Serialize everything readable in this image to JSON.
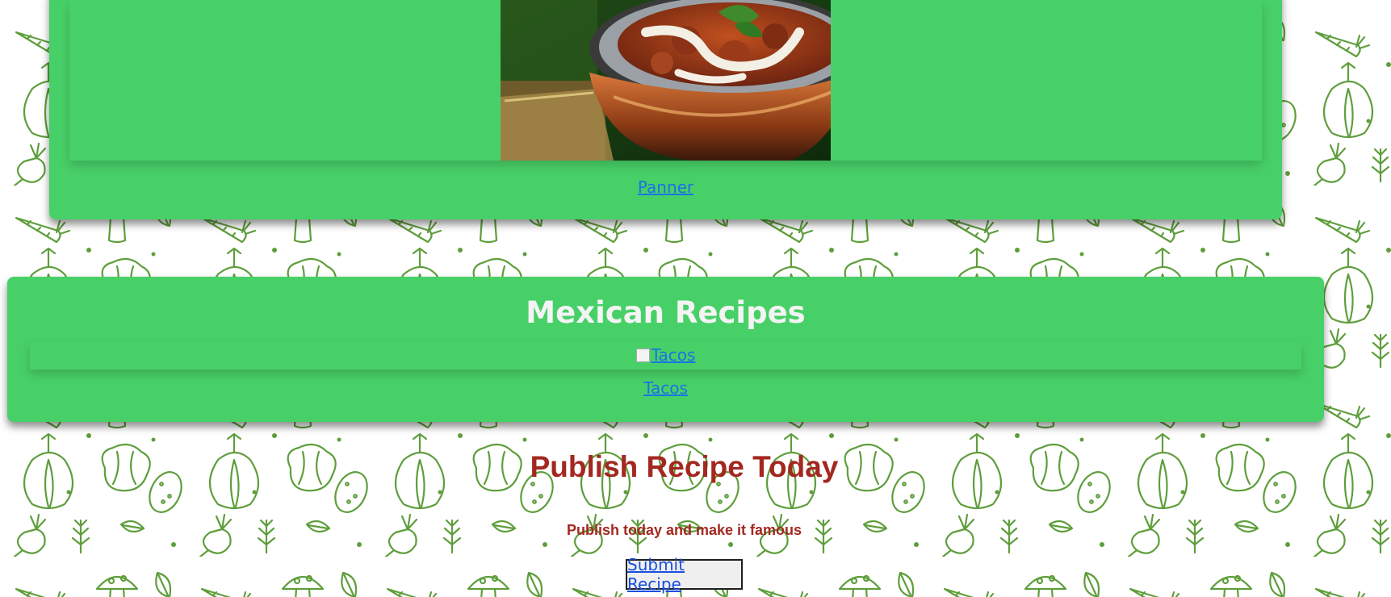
{
  "colors": {
    "card_green": "#48d068",
    "link_blue": "#1a73e8",
    "heading_red": "#a32820",
    "pattern_green": "#5e9e3c"
  },
  "background": {
    "pattern_icons": [
      "carrot-icon",
      "mushroom-icon",
      "garlic-icon",
      "leaf-icon",
      "cabbage-icon",
      "potato-icon",
      "radish-icon",
      "herb-icon"
    ]
  },
  "indian_section": {
    "recipe_image_alt": "Panner",
    "recipe_link": "Panner"
  },
  "mexican_section": {
    "title": "Mexican Recipes",
    "recipe_image_alt": "Tacos",
    "recipe_link": "Tacos"
  },
  "publish": {
    "title": "Publish Recipe Today",
    "subtitle": "Publish today and make it famous",
    "button": "Submit Recipe"
  }
}
